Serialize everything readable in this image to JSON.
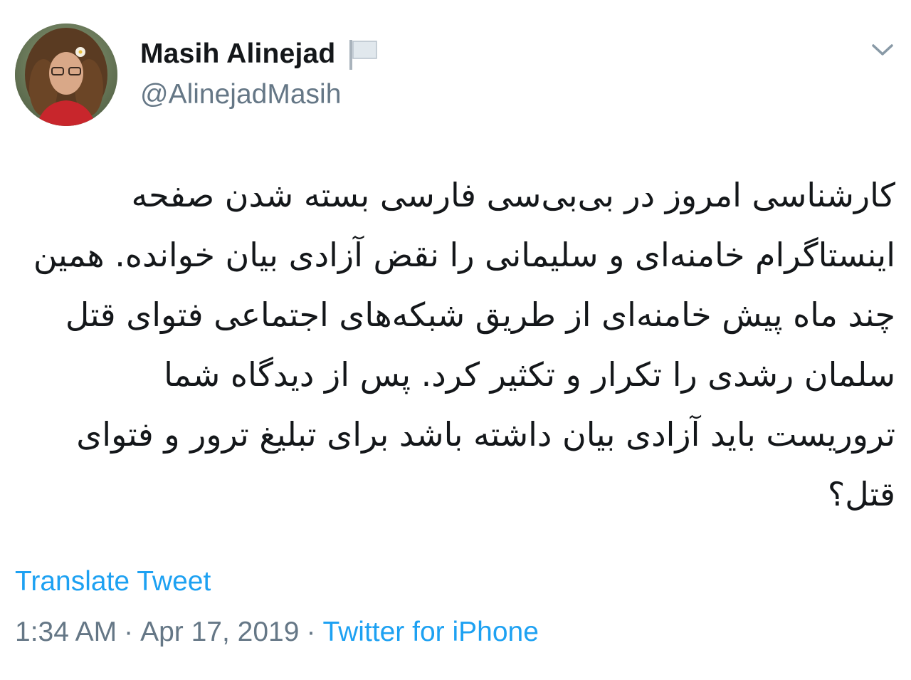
{
  "author": {
    "display_name": "Masih Alinejad",
    "handle": "@AlinejadMasih",
    "flag_icon": "white-flag-icon"
  },
  "menu": {
    "icon": "chevron-down-icon"
  },
  "tweet": {
    "text": "کارشناسی امروز در بی‌بی‌سی فارسی بسته شدن صفحه اینستاگرام خامنه‌ای و سلیمانی را نقض آزادی بیان خوانده. همین چند ماه پیش خامنه‌ای از طریق شبکه‌های اجتماعی فتوای قتل سلمان رشدی را تکرار و تکثیر کرد. پس از دیدگاه شما تروریست باید آزادی بیان داشته باشد برای تبلیغ ترور و فتوای قتل؟",
    "translate_label": "Translate Tweet",
    "time": "1:34 AM",
    "date": "Apr 17, 2019",
    "separator": "·",
    "source": "Twitter for iPhone"
  },
  "colors": {
    "link": "#1da1f2",
    "secondary": "#657786",
    "primary": "#14171a"
  }
}
